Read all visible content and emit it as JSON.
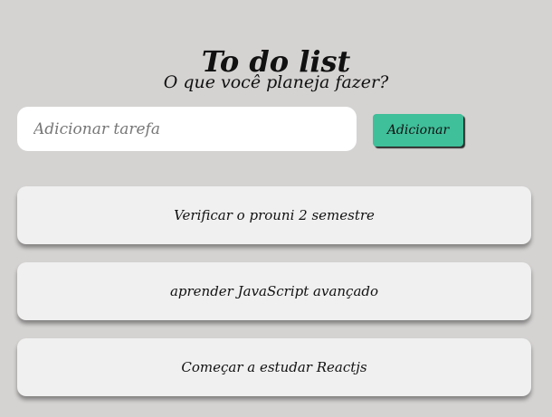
{
  "header": {
    "title": "To do list",
    "subtitle": "O que você planeja fazer?"
  },
  "form": {
    "input_placeholder": "Adicionar tarefa",
    "input_value": "",
    "add_button_label": "Adicionar"
  },
  "tasks": [
    {
      "text": "Verificar o prouni 2 semestre"
    },
    {
      "text": "aprender JavaScript avançado"
    },
    {
      "text": "Começar a estudar Reactjs"
    }
  ],
  "colors": {
    "background": "#d5d3d2",
    "accent": "#3fbf9a",
    "card": "#f0f0f0"
  }
}
